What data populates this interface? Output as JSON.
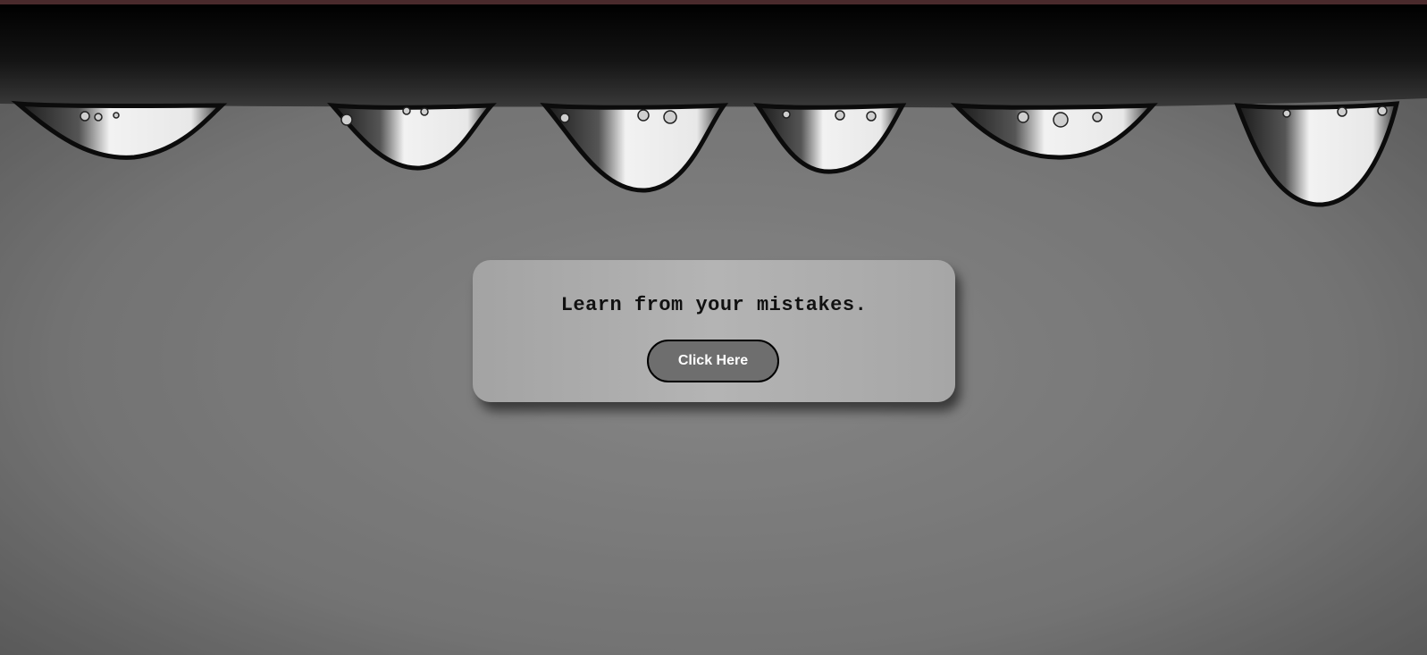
{
  "hero": {
    "message": "Learn from your mistakes.",
    "button_label": "Click Here"
  },
  "theme": {
    "top_strip_color": "#4a2a2c",
    "button_color": "#6e6e6e",
    "card_color": "#b0b0b0"
  }
}
